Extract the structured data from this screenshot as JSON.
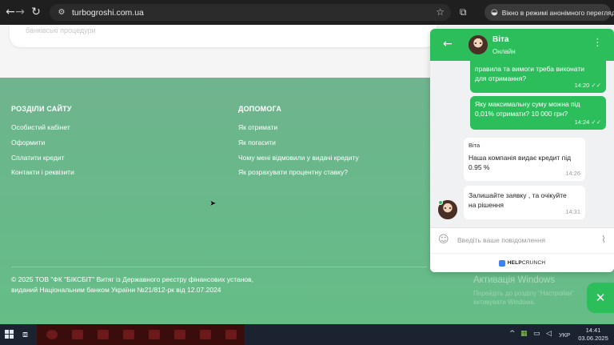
{
  "browser": {
    "url": "turbogroshi.com.ua",
    "incognito_label": "Вікно в режимі анонімного перегляду",
    "icons": [
      "back-arrow-icon",
      "forward-arrow-icon",
      "reload-icon",
      "site-info-icon",
      "bookmark-star-icon",
      "extensions-icon",
      "incognito-icon"
    ]
  },
  "top_card": {
    "text": "банківські процедури"
  },
  "footer": {
    "sections": [
      {
        "heading": "РОЗДІЛИ САЙТУ",
        "links": [
          "Особистий кабінет",
          "Оформити",
          "Сплатити кредит",
          "Контакти і реквізити"
        ]
      },
      {
        "heading": "ДОПОМОГА",
        "links": [
          "Як отримати",
          "Як погасити",
          "Чому мені відмовили у видачі кредиту",
          "Як розрахувати процентну ставку?"
        ]
      }
    ],
    "copyright_line1": "© 2025 ТОВ \"ФК \"БІКСБІТ\" Витяг із Державного реєстру фінансових установ,",
    "copyright_line2": "виданий Національним банком України №21/812-рк від 12.07.2024",
    "bg_color": "#6bb98a"
  },
  "chat": {
    "agent_name": "Віта",
    "agent_status": "Онлайн",
    "accent_color": "#2bbe5b",
    "messages": [
      {
        "direction": "out",
        "lines": [
          "правила та вимоги треба виконати",
          "для отримання?"
        ],
        "time": "14:20"
      },
      {
        "direction": "out",
        "lines": [
          "Яку максимальну суму можна під",
          "0,01% отримати? 10 000 грн?"
        ],
        "time": "14:24"
      },
      {
        "direction": "in",
        "sender": "Віта",
        "lines": [
          "Наша компанія видає кредит під",
          "0.95 %"
        ],
        "time": "14:26"
      },
      {
        "direction": "in",
        "lines": [
          "Залишайте заявку , та очікуйте",
          "на рішення"
        ],
        "time": "14:31"
      }
    ],
    "input_placeholder": "Введіть ваше повідомлення",
    "brand": {
      "bold": "HELP",
      "rest": "CRUNCH"
    }
  },
  "windows_watermark": {
    "title": "Активація Windows",
    "line1": "Перейдіть до розділу \"Настройки\"",
    "line2": "активувати Windows."
  },
  "taskbar": {
    "language": "УКР",
    "time": "14:41",
    "date": "03.06.2025"
  }
}
